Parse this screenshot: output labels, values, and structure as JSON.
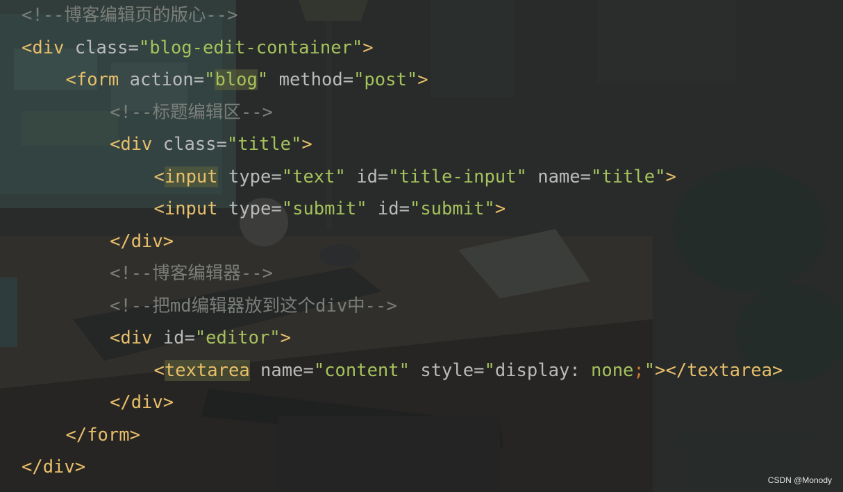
{
  "editor": {
    "lines": [
      {
        "parts": [
          {
            "k": "c",
            "t": "<!--博客编辑页的版心-->"
          }
        ]
      },
      {
        "parts": [
          {
            "k": "t",
            "t": "<div "
          },
          {
            "k": "a",
            "t": "class="
          },
          {
            "k": "s",
            "t": "\"blog-edit-container\""
          },
          {
            "k": "t",
            "t": ">"
          }
        ]
      },
      {
        "parts": [
          {
            "k": "t",
            "t": "<form "
          },
          {
            "k": "a",
            "t": "action="
          },
          {
            "k": "s",
            "t": "\""
          },
          {
            "k": "s",
            "t": "blog",
            "hl": true
          },
          {
            "k": "s",
            "t": "\" "
          },
          {
            "k": "a",
            "t": "method="
          },
          {
            "k": "s",
            "t": "\"post\""
          },
          {
            "k": "t",
            "t": ">"
          }
        ]
      },
      {
        "parts": [
          {
            "k": "c",
            "t": "<!--标题编辑区-->"
          }
        ]
      },
      {
        "parts": [
          {
            "k": "t",
            "t": "<div "
          },
          {
            "k": "a",
            "t": "class="
          },
          {
            "k": "s",
            "t": "\"title\""
          },
          {
            "k": "t",
            "t": ">"
          }
        ]
      },
      {
        "parts": [
          {
            "k": "t",
            "t": "<"
          },
          {
            "k": "t",
            "t": "input",
            "hl": true
          },
          {
            "k": "a",
            "t": " type="
          },
          {
            "k": "s",
            "t": "\"text\" "
          },
          {
            "k": "a",
            "t": "id="
          },
          {
            "k": "s",
            "t": "\"title-input\" "
          },
          {
            "k": "a",
            "t": "name="
          },
          {
            "k": "s",
            "t": "\"title\""
          },
          {
            "k": "t",
            "t": ">"
          }
        ]
      },
      {
        "parts": [
          {
            "k": "t",
            "t": "<input "
          },
          {
            "k": "a",
            "t": "type="
          },
          {
            "k": "s",
            "t": "\"submit\" "
          },
          {
            "k": "a",
            "t": "id="
          },
          {
            "k": "s",
            "t": "\"submit\""
          },
          {
            "k": "t",
            "t": ">"
          }
        ]
      },
      {
        "parts": [
          {
            "k": "t",
            "t": "</div>"
          }
        ]
      },
      {
        "parts": [
          {
            "k": "c",
            "t": "<!--博客编辑器-->"
          }
        ]
      },
      {
        "parts": [
          {
            "k": "c",
            "t": "<!--把md编辑器放到这个div中-->"
          }
        ]
      },
      {
        "parts": [
          {
            "k": "t",
            "t": "<div "
          },
          {
            "k": "a",
            "t": "id="
          },
          {
            "k": "s",
            "t": "\"editor\""
          },
          {
            "k": "t",
            "t": ">"
          }
        ]
      },
      {
        "parts": [
          {
            "k": "t",
            "t": "<"
          },
          {
            "k": "t",
            "t": "textarea",
            "hl": true
          },
          {
            "k": "a",
            "t": " name="
          },
          {
            "k": "s",
            "t": "\"content\" "
          },
          {
            "k": "a",
            "t": "style="
          },
          {
            "k": "s",
            "t": "\""
          },
          {
            "k": "a",
            "t": "display: "
          },
          {
            "k": "s",
            "t": "none"
          },
          {
            "k": "sc",
            "t": ";"
          },
          {
            "k": "s",
            "t": "\""
          },
          {
            "k": "t",
            "t": "></textarea>"
          }
        ]
      },
      {
        "parts": [
          {
            "k": "t",
            "t": "</div>"
          }
        ]
      },
      {
        "parts": [
          {
            "k": "t",
            "t": "</form>"
          }
        ]
      },
      {
        "parts": [
          {
            "k": "t",
            "t": "</div>"
          }
        ]
      }
    ]
  },
  "watermark": "CSDN @Monody"
}
